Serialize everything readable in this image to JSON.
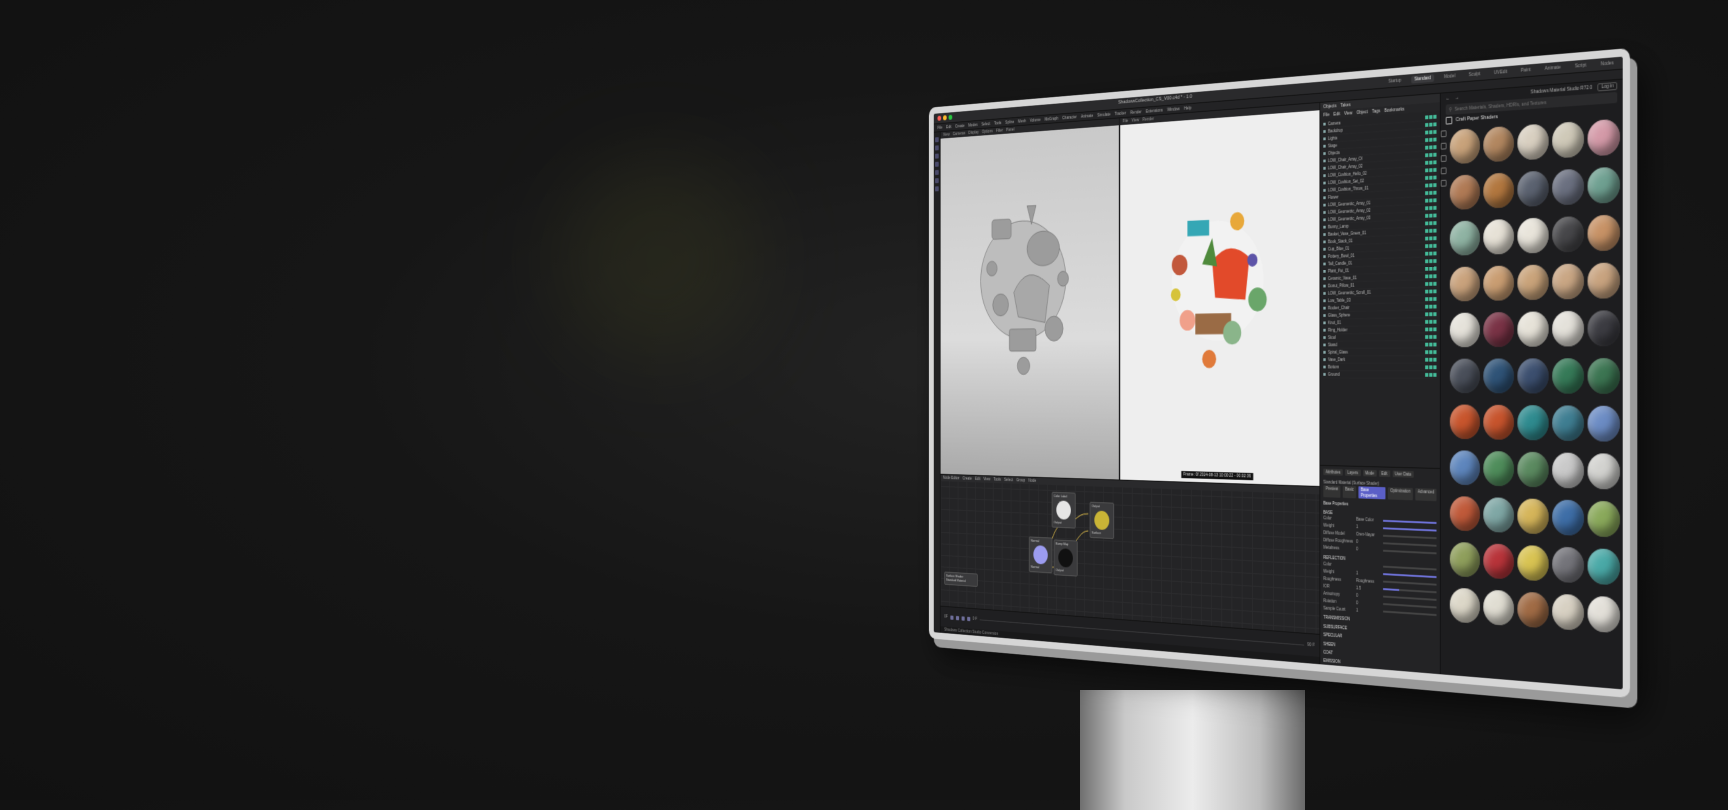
{
  "window": {
    "title": "ShadowsCollection_CS_V00.c4d * - 1.0",
    "layouts": [
      "Startup",
      "Standard",
      "Model",
      "Sculpt",
      "UVEdit",
      "Paint",
      "Animate",
      "Script",
      "Nodes"
    ],
    "active_layout": "Standard"
  },
  "menubar": [
    "File",
    "Edit",
    "Create",
    "Modes",
    "Select",
    "Tools",
    "Spline",
    "Mesh",
    "Volume",
    "MoGraph",
    "Character",
    "Animate",
    "Simulate",
    "Tracker",
    "Render",
    "Extensions",
    "Window",
    "Help"
  ],
  "viewport_left": {
    "header": [
      "View",
      "Cameras",
      "Display",
      "Options",
      "Filter",
      "Panel"
    ]
  },
  "viewport_right": {
    "header": [
      "File",
      "View",
      "Render"
    ],
    "caption": "Frame: 0f  2024-08-13 10:00:22 - 00:02:36"
  },
  "node_editor": {
    "title": "Node Editor",
    "menu": [
      "Create",
      "Edit",
      "View",
      "Tools",
      "Select",
      "Group",
      "Node"
    ],
    "nodes": [
      {
        "title": "Color Label",
        "out": "Output"
      },
      {
        "title": "Normal",
        "out": "Normal"
      },
      {
        "title": "Bump Map",
        "out": "Output"
      },
      {
        "title": "Output",
        "out": "Surface"
      }
    ],
    "selection_info": [
      "Surface Shader",
      "Standard Material"
    ]
  },
  "timeline": {
    "start": "0F",
    "end": "90 F",
    "current": "0 F"
  },
  "status": "Shadows Collection Studio Conversion",
  "objects_panel": {
    "tabs": [
      "Objects",
      "Takes"
    ],
    "menu": [
      "File",
      "Edit",
      "View",
      "Object",
      "Tags",
      "Bookmarks"
    ],
    "rows": [
      "Camera",
      "Backdrop",
      "Lights",
      "Stage",
      "Objects",
      "LOW_Chair_Array_Ol",
      "LOW_Chair_Array_02",
      "LOW_Cushion_Hello_02",
      "LOW_Cushion_Set_02",
      "LOW_Cushion_Throw_01",
      "Flower",
      "LOW_Geometric_Array_01",
      "LOW_Geometric_Array_02",
      "LOW_Geometric_Array_03",
      "Bunny_Lamp",
      "Basket_Vase_Green_01",
      "Book_Stack_01",
      "Cup_Blue_01",
      "Pottery_Bowl_01",
      "Tall_Candle_01",
      "Plant_Pot_01",
      "Ceramic_Vase_01",
      "Donut_Pillow_01",
      "LOW_Geometric_Scroll_01",
      "Low_Table_03",
      "Rocker_Chair",
      "Glass_Sphere",
      "Knot_01",
      "Ring_Holder",
      "Stool",
      "Stand",
      "Spiral_Glass",
      "Vase_Dark",
      "Bottom",
      "Ground"
    ]
  },
  "attributes_panel": {
    "tabs": [
      "Attributes",
      "Layers"
    ],
    "menu": [
      "Mode",
      "Edit",
      "User Data"
    ],
    "material_name": "Standard Material (Surface Shader)",
    "subtabs": [
      "Preview",
      "Basic",
      "Base Properties",
      "Optimization",
      "Advanced"
    ],
    "active_subtab": "Base Properties",
    "group_title": "Base Properties",
    "sections": [
      "BASE",
      "REFLECTION",
      "TRANSMISSION",
      "SUBSURFACE",
      "SPECULAR",
      "SHEEN",
      "COAT",
      "EMISSION",
      "GEOMETRY"
    ],
    "rows": [
      {
        "label": "Color",
        "value": "Base Color",
        "level": 1.0
      },
      {
        "label": "Weight",
        "value": "1",
        "level": 1.0
      },
      {
        "label": "Diffuse Model",
        "value": "Oren-Nayar",
        "level": 0.0
      },
      {
        "label": "Diffuse Roughness",
        "value": "0",
        "level": 0.0
      },
      {
        "label": "Metalness",
        "value": "0",
        "level": 0.0
      },
      {
        "label": "Color",
        "value": "",
        "level": 0.0
      },
      {
        "label": "Weight",
        "value": "1",
        "level": 1.0
      },
      {
        "label": "Roughness",
        "value": "Roughness",
        "level": 0.0
      },
      {
        "label": "IOR",
        "value": "1.5",
        "level": 0.3
      },
      {
        "label": "Anisotropy",
        "value": "0",
        "level": 0.0
      },
      {
        "label": "Rotation",
        "value": "0",
        "level": 0.0
      },
      {
        "label": "Sample Count",
        "value": "1",
        "level": 0.0
      }
    ]
  },
  "material_library": {
    "app_title": "Shadows Material Studio R72.0",
    "search_placeholder": "Search Materials, Shaders, HDRIs, and Textures",
    "category": "Craft Paper Shaders",
    "button": "Log in",
    "spheres": [
      "#c8a27a",
      "#b28760",
      "#d8cfc0",
      "#cfc9b8",
      "#d49aa8",
      "#b07a55",
      "#b2773f",
      "#5b6270",
      "#6b7080",
      "#6fa091",
      "#8fb3a3",
      "#e6e1d6",
      "#e8e4da",
      "#47474a",
      "#c79266",
      "#c9a27c",
      "#c99d72",
      "#c9a37a",
      "#c9a684",
      "#c8a37f",
      "#e5e2da",
      "#7a3346",
      "#e6e2d8",
      "#e4e1da",
      "#3c3c42",
      "#4a4f5a",
      "#2f5377",
      "#3c4f6f",
      "#367a58",
      "#3c7552",
      "#c8552d",
      "#c7542d",
      "#2f8b8f",
      "#3f7e92",
      "#6c8cc4",
      "#5e86bd",
      "#4f8d5b",
      "#5b8a60",
      "#c9c9c9",
      "#d2d2cf",
      "#c05a3a",
      "#7fa7a5",
      "#d5b55a",
      "#3e6ea7",
      "#8aa95b",
      "#8f9f5c",
      "#b8343a",
      "#d8c352",
      "#74747a",
      "#4aa9a7",
      "#dcd7c8",
      "#e0ddd2",
      "#a06b45",
      "#d7d0c2",
      "#e2dfd8"
    ]
  },
  "colors": {
    "accent": "#5b5fc7",
    "screen_bg": "#1c1c1e",
    "bezel": "#d6d6d6"
  }
}
